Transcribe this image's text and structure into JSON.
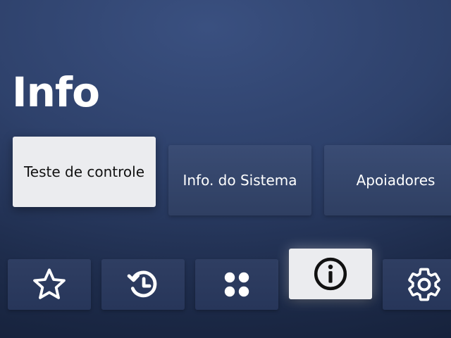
{
  "page": {
    "title": "Info"
  },
  "cards": [
    {
      "label": "Teste de controle",
      "focused": true
    },
    {
      "label": "Info. do Sistema",
      "focused": false
    },
    {
      "label": "Apoiadores",
      "focused": false
    }
  ],
  "nav": {
    "items": [
      {
        "icon": "star-icon",
        "focused": false
      },
      {
        "icon": "history-icon",
        "focused": false
      },
      {
        "icon": "apps-grid-icon",
        "focused": false
      },
      {
        "icon": "info-icon",
        "focused": true
      },
      {
        "icon": "gear-icon",
        "focused": false
      }
    ]
  },
  "colors": {
    "background": "#2e416b",
    "card_unfocused": "#34466b",
    "card_focused": "#ebecef",
    "text_light": "#ffffff",
    "text_dark": "#111111"
  }
}
